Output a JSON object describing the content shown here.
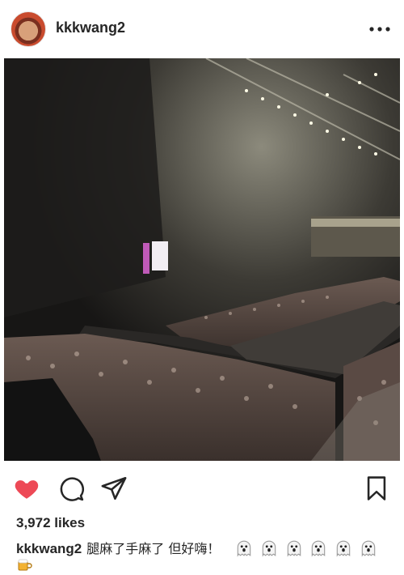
{
  "post": {
    "username": "kkkwang2",
    "likes": "3,972 likes",
    "caption_text": "腿麻了手麻了 但好嗨！",
    "caption_emojis": [
      "ghost",
      "ghost",
      "ghost",
      "ghost",
      "ghost",
      "ghost"
    ],
    "extra_emoji": "beer-mug",
    "photo_subject": "concert-arena-crowd"
  },
  "icons": {
    "more": "more-dots-icon",
    "like": "heart-icon",
    "comment": "comment-icon",
    "share": "send-icon",
    "save": "bookmark-icon"
  },
  "colors": {
    "heart": "#ed4956",
    "text": "#262626"
  }
}
